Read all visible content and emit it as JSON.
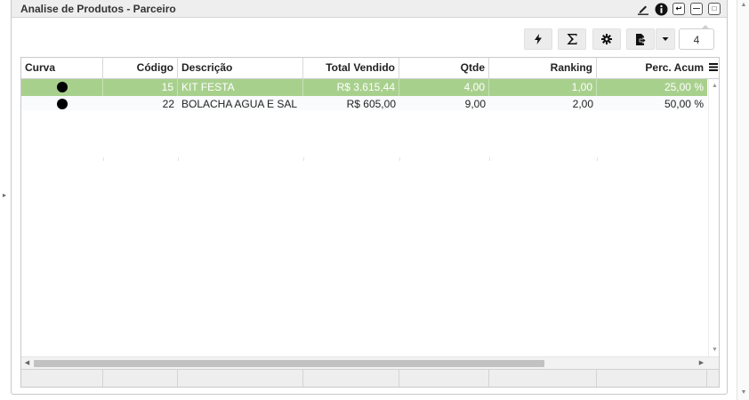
{
  "panel": {
    "title": "Analise de Produtos - Parceiro",
    "title_icons": [
      "pencil-icon",
      "info-icon",
      "restore-icon",
      "minimize-icon",
      "maximize-icon"
    ]
  },
  "toolbar": {
    "buttons": [
      "lightning-icon",
      "sum-icon",
      "gear-icon",
      "export-icon",
      "chevron-down-icon"
    ],
    "count_value": "4"
  },
  "grid": {
    "columns": [
      "Curva",
      "Código",
      "Descrição",
      "Total Vendido",
      "Qtde",
      "Ranking",
      "Perc. Acum"
    ],
    "rows": [
      {
        "curva": "dot",
        "codigo": "15",
        "descricao": "KIT FESTA",
        "total": "R$ 3.615,44",
        "qtde": "4,00",
        "ranking": "1,00",
        "perc": "25,00 %",
        "selected": true
      },
      {
        "curva": "dot",
        "codigo": "22",
        "descricao": "BOLACHA AGUA E SAL",
        "total": "R$ 605,00",
        "qtde": "9,00",
        "ranking": "2,00",
        "perc": "50,00 %",
        "selected": false
      }
    ]
  },
  "colors": {
    "selected_row": "#a8d08d",
    "titlebar": "#eeeeee",
    "toolbar_button": "#ececec"
  }
}
